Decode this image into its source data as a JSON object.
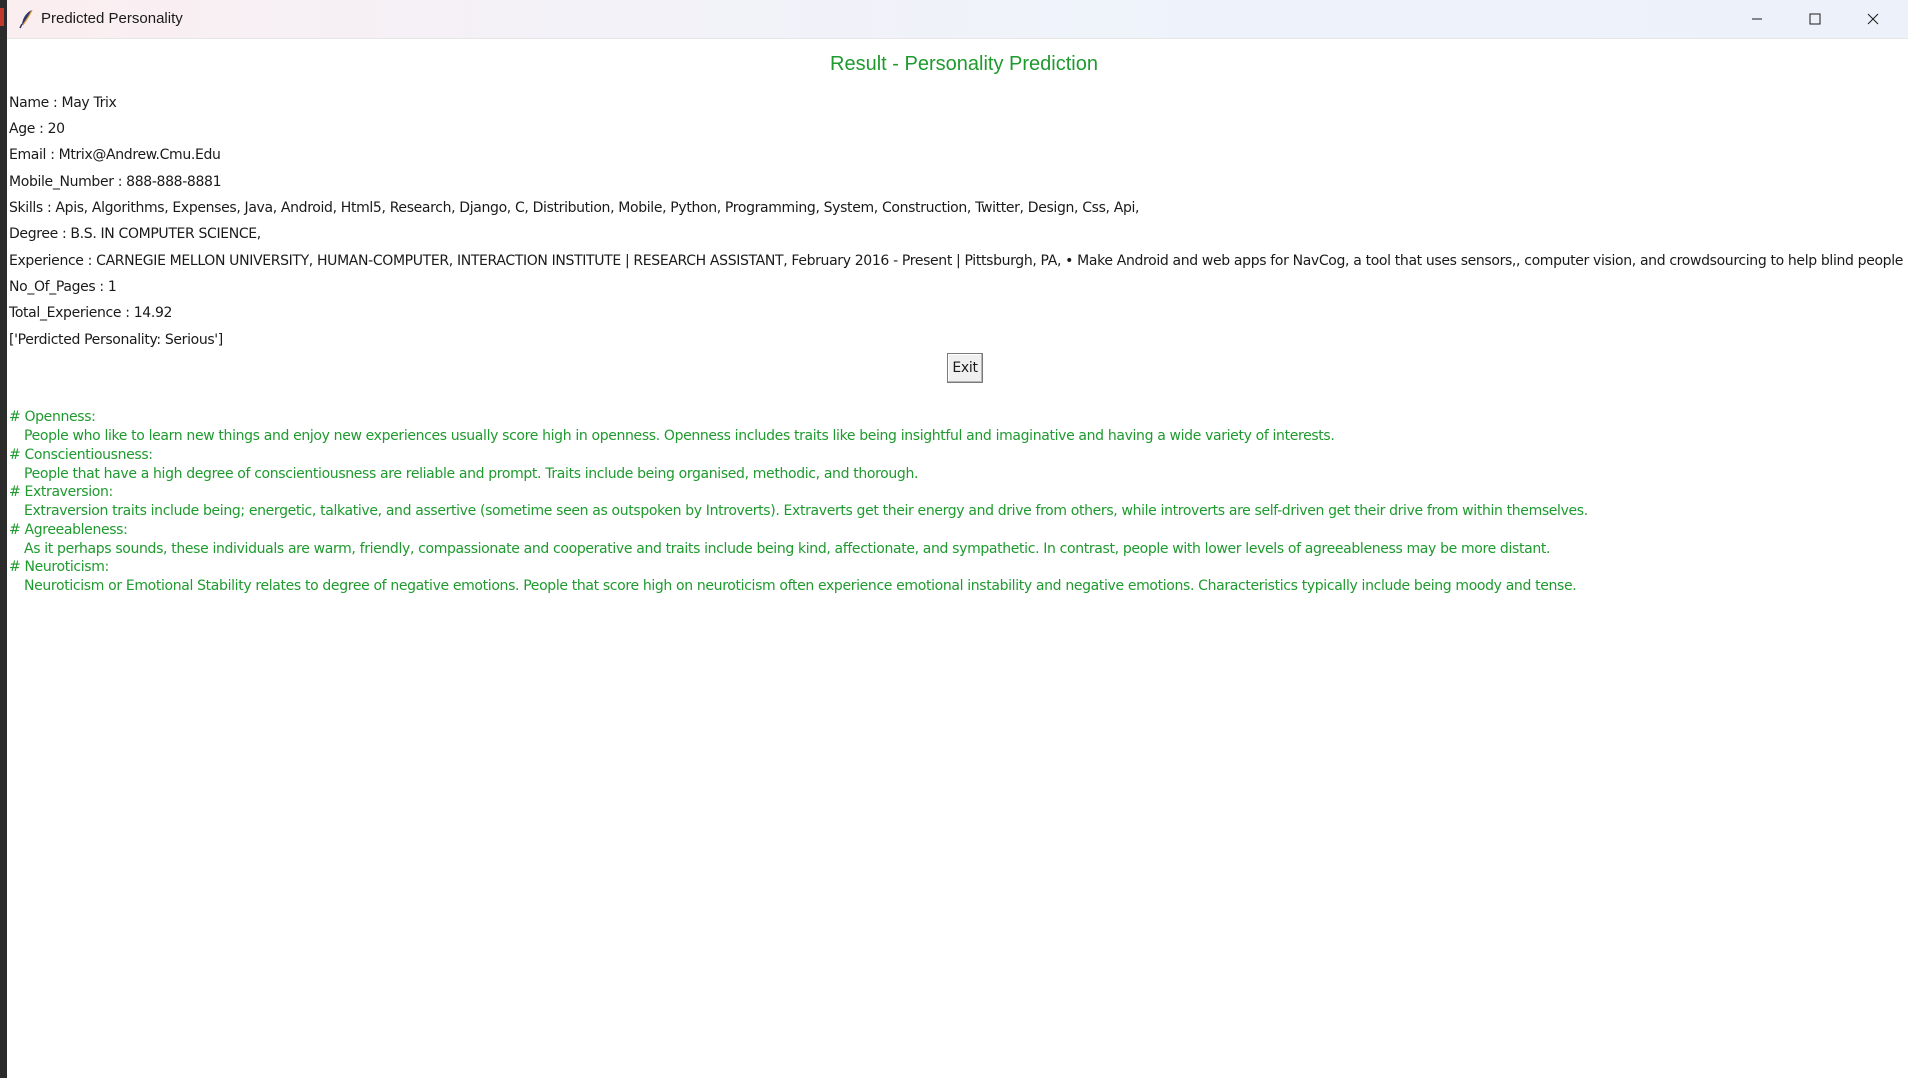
{
  "window": {
    "title": "Predicted Personality",
    "icons": {
      "app": "feather-icon",
      "minimize": "minimize-icon",
      "maximize": "maximize-icon",
      "close": "close-icon"
    }
  },
  "main": {
    "heading": "Result - Personality Prediction",
    "heading_color": "#1e9a2e",
    "fields": [
      "Name : May Trix",
      "Age : 20",
      "Email : Mtrix@Andrew.Cmu.Edu",
      "Mobile_Number : 888-888-8881",
      "Skills : Apis, Algorithms, Expenses, Java, Android, Html5, Research, Django, C, Distribution, Mobile, Python, Programming, System, Construction, Twitter, Design, Css, Api,",
      "Degree : B.S. IN COMPUTER SCIENCE,",
      "Experience : CARNEGIE MELLON UNIVERSITY, HUMAN-COMPUTER, INTERACTION INSTITUTE  | RESEARCH ASSISTANT, February 2016 - Present | Pittsburgh, PA, • Make Android and web apps for NavCog, a tool that uses sensors,, computer vision, and crowdsourcing to help blind people m",
      "No_Of_Pages : 1",
      "Total_Experience : 14.92",
      "['Perdicted Personality: Serious']"
    ],
    "exit_label": "Exit"
  },
  "traits": [
    {
      "heading": "# Openness:",
      "description": "People who like to learn new things and enjoy new experiences usually score high in openness. Openness includes traits like being insightful and imaginative and having a wide variety of interests."
    },
    {
      "heading": "# Conscientiousness:",
      "description": "People that have a high degree of conscientiousness are reliable and prompt. Traits include being organised, methodic, and thorough."
    },
    {
      "heading": "# Extraversion:",
      "description": "Extraversion traits include being; energetic, talkative, and assertive (sometime seen as outspoken by Introverts). Extraverts get their energy and drive from others, while introverts are self-driven get their drive from within themselves."
    },
    {
      "heading": "# Agreeableness:",
      "description": "As it perhaps sounds, these individuals are warm, friendly, compassionate and cooperative and traits include being kind, affectionate, and sympathetic. In contrast, people with lower levels of agreeableness may be more distant."
    },
    {
      "heading": "# Neuroticism:",
      "description": "Neuroticism or Emotional Stability relates to degree of negative emotions. People that score high on neuroticism often experience emotional instability and negative emotions. Characteristics typically include being moody and tense."
    }
  ]
}
